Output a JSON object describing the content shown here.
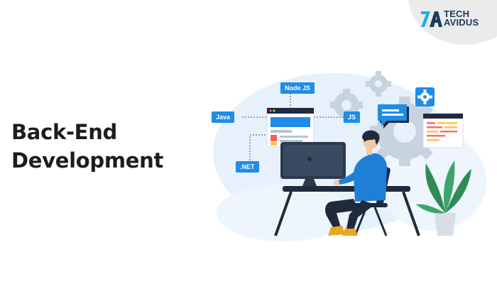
{
  "brand": {
    "line1": "TECH",
    "line2": "AVIDUS",
    "mark_icon": "tech-avidus-7a-logo-mark",
    "colors": {
      "navy": "#1a3b5c",
      "cyan": "#19b2e8"
    }
  },
  "headline": {
    "line1": "Back-End",
    "line2": "Development"
  },
  "illustration": {
    "tags": {
      "nodejs": "Node JS",
      "java": "Java",
      "js": "JS",
      "net": ".NET"
    },
    "icons": [
      "gear-icon",
      "browser-window-icon",
      "chat-bubble-icon",
      "settings-badge-icon",
      "monitor-icon",
      "plant-icon"
    ],
    "colors": {
      "accent_blue": "#1f8ce6",
      "shirt_blue": "#1f7fd8",
      "dark_navy": "#1f2b3d",
      "pale_blue": "#e6f1fb",
      "gear_gray": "#c7d3df",
      "leaf_green": "#2e8b57"
    }
  }
}
